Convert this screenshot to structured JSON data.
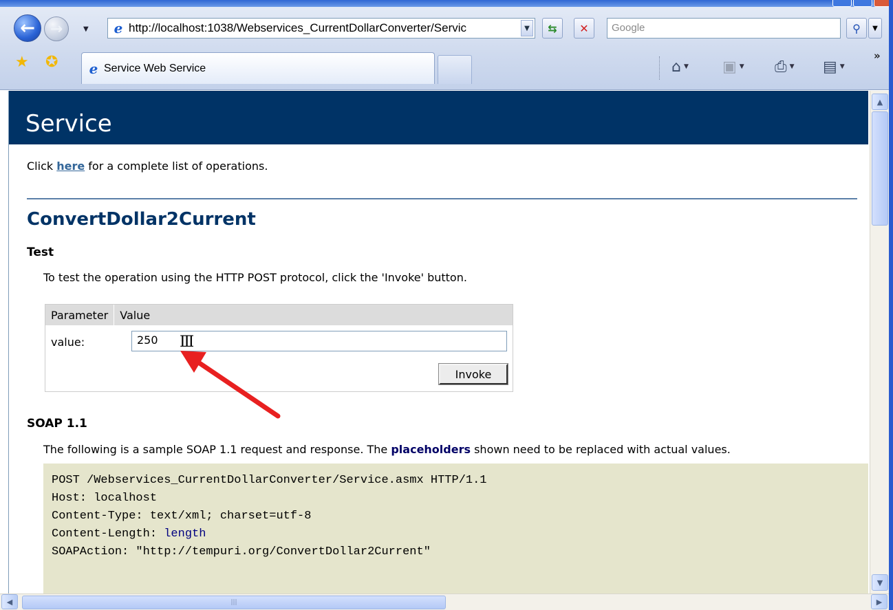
{
  "browser": {
    "address_url": "http://localhost:1038/Webservices_CurrentDollarConverter/Servic",
    "search_placeholder": "Google",
    "tab_title": "Service Web Service",
    "more_chevron": "»"
  },
  "page": {
    "banner_title": "Service",
    "intro_before": "Click ",
    "intro_link": "here",
    "intro_after": " for a complete list of operations.",
    "operation_title": "ConvertDollar2Current",
    "test_heading": "Test",
    "test_description": "To test the operation using the HTTP POST protocol, click the 'Invoke' button.",
    "form": {
      "col_parameter": "Parameter",
      "col_value": "Value",
      "param_label": "value:",
      "param_value": "250",
      "invoke_label": "Invoke"
    },
    "soap_heading": "SOAP 1.1",
    "soap_desc_before": "The following is a sample SOAP 1.1 request and response. The ",
    "soap_desc_highlight": "placeholders",
    "soap_desc_after": " shown need to be replaced with actual values.",
    "code": {
      "line1": "POST /Webservices_CurrentDollarConverter/Service.asmx HTTP/1.1",
      "line2": "Host: localhost",
      "line3": "Content-Type: text/xml; charset=utf-8",
      "line4_key": "Content-Length: ",
      "line4_val": "length",
      "line5": "SOAPAction: \"http://tempuri.org/ConvertDollar2Current\""
    }
  },
  "annotation": {
    "arrow_color": "#e82020"
  },
  "colors": {
    "banner": "#003366",
    "heading": "#003366",
    "code_bg": "#e5e5cc"
  }
}
